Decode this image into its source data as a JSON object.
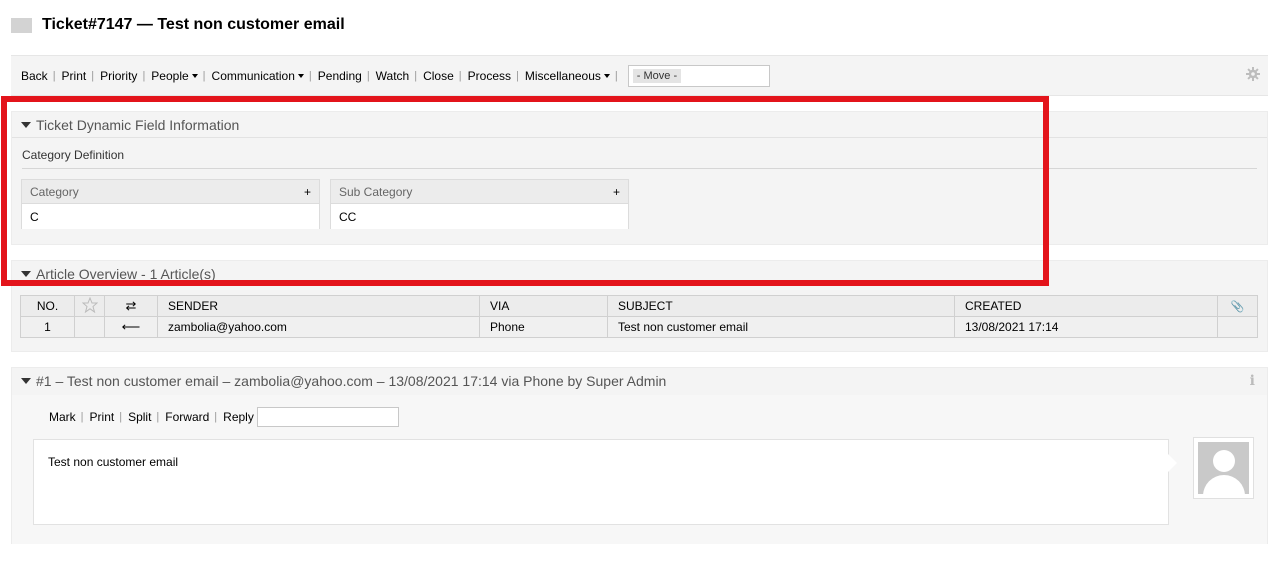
{
  "header": {
    "title": "Ticket#7147 — Test non customer email"
  },
  "actions": {
    "items": [
      {
        "label": "Back",
        "dropdown": false
      },
      {
        "label": "Print",
        "dropdown": false
      },
      {
        "label": "Priority",
        "dropdown": false
      },
      {
        "label": "People",
        "dropdown": true
      },
      {
        "label": "Communication",
        "dropdown": true
      },
      {
        "label": "Pending",
        "dropdown": false
      },
      {
        "label": "Watch",
        "dropdown": false
      },
      {
        "label": "Close",
        "dropdown": false
      },
      {
        "label": "Process",
        "dropdown": false
      },
      {
        "label": "Miscellaneous",
        "dropdown": true
      }
    ],
    "move_value": "- Move -",
    "settings_icon": "gear-icon"
  },
  "dynamic_fields": {
    "title": "Ticket Dynamic Field Information",
    "group_label": "Category Definition",
    "fields": [
      {
        "label": "Category",
        "value": "C"
      },
      {
        "label": "Sub Category",
        "value": "CC"
      }
    ]
  },
  "article_overview": {
    "title": "Article Overview - 1 Article(s)",
    "columns": {
      "no": "NO.",
      "sender": "SENDER",
      "via": "VIA",
      "subject": "SUBJECT",
      "created": "CREATED"
    },
    "rows": [
      {
        "no": "1",
        "sender": "zambolia@yahoo.com",
        "via": "Phone",
        "subject": "Test non customer email",
        "created": "13/08/2021 17:14"
      }
    ]
  },
  "article_detail": {
    "title": "#1 – Test non customer email – zambolia@yahoo.com – 13/08/2021 17:14 via Phone by Super Admin",
    "actions": [
      "Mark",
      "Print",
      "Split",
      "Forward",
      "Reply"
    ],
    "body": "Test non customer email"
  },
  "colors": {
    "highlight": "#e3141b",
    "widget_bg": "#f4f4f4"
  }
}
